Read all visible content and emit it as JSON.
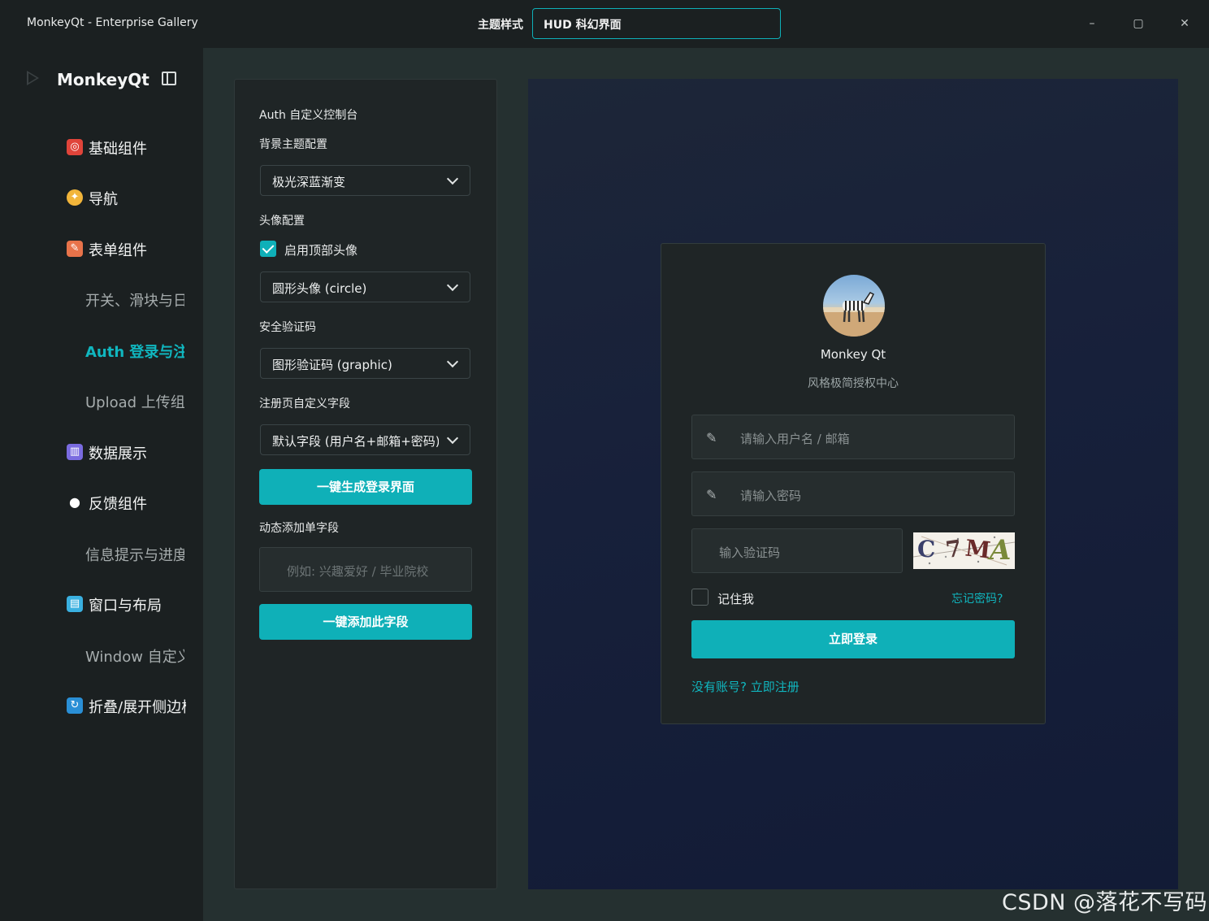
{
  "window": {
    "title": "MonkeyQt - Enterprise Gallery",
    "theme_label": "主题样式",
    "theme_value": "HUD 科幻界面",
    "minimize": "–",
    "maximize": "▢",
    "close": "✕"
  },
  "sidebar": {
    "logo": "MonkeyQt",
    "items": [
      {
        "label": "基础组件",
        "icon": "target-icon",
        "icon_color": "#e0443a"
      },
      {
        "label": "导航",
        "icon": "compass-icon",
        "icon_color": "#f2b53a"
      },
      {
        "label": "表单组件",
        "icon": "form-icon",
        "icon_color": "#e8734a"
      },
      {
        "label": "开关、滑块与日",
        "sub": true
      },
      {
        "label": "Auth 登录与注",
        "sub": true,
        "active": true
      },
      {
        "label": "Upload 上传组件",
        "sub": true
      },
      {
        "label": "数据展示",
        "icon": "chart-icon",
        "icon_color": "#7a6be0"
      },
      {
        "label": "反馈组件",
        "icon": "chat-bubble-icon",
        "icon_color": "#ffffff"
      },
      {
        "label": "信息提示与进度",
        "sub": true
      },
      {
        "label": "窗口与布局",
        "icon": "window-icon",
        "icon_color": "#3ab0e0"
      },
      {
        "label": "Window 自定义",
        "sub": true
      },
      {
        "label": "折叠/展开侧边栏",
        "icon": "refresh-icon",
        "icon_color": "#2a8fd6"
      }
    ]
  },
  "panel": {
    "heading": "Auth 自定义控制台",
    "bg_label": "背景主题配置",
    "bg_value": "极光深蓝渐变",
    "avatar_label": "头像配置",
    "avatar_checkbox": "启用顶部头像",
    "avatar_value": "圆形头像 (circle)",
    "captcha_label": "安全验证码",
    "captcha_value": "图形验证码 (graphic)",
    "register_label": "注册页自定义字段",
    "register_value": "默认字段 (用户名+邮箱+密码)",
    "generate_button": "一键生成登录界面",
    "dynamic_label": "动态添加单字段",
    "dynamic_placeholder": "例如: 兴趣爱好 / 毕业院校",
    "add_button": "一键添加此字段"
  },
  "login_card": {
    "name": "Monkey Qt",
    "subtitle": "风格极简授权中心",
    "username_placeholder": "请输入用户名 / 邮箱",
    "password_placeholder": "请输入密码",
    "captcha_placeholder": "输入验证码",
    "captcha_chars": [
      "C",
      "7",
      "M",
      "A"
    ],
    "remember": "记住我",
    "forgot": "忘记密码?",
    "login_button": "立即登录",
    "register_link": "没有账号? 立即注册"
  },
  "watermark": "CSDN @落花不写码",
  "colors": {
    "accent": "#0fb0b8",
    "background": "#1b2021",
    "panel": "#1f2526"
  }
}
